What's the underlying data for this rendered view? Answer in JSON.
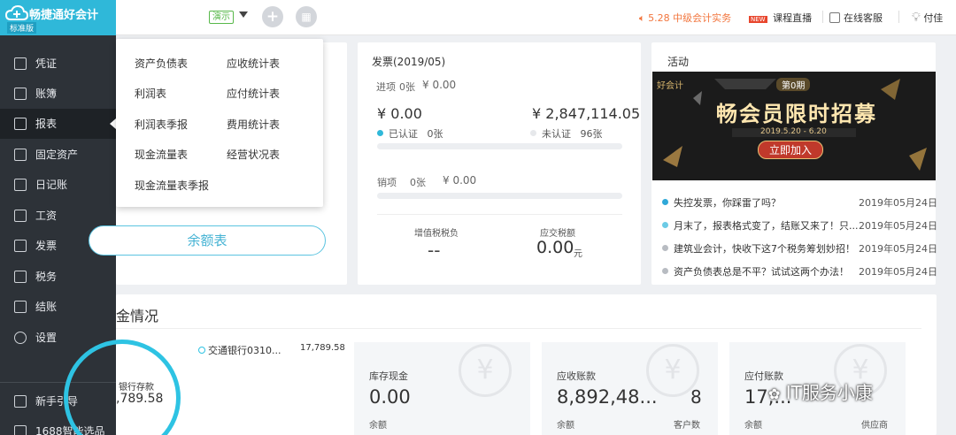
{
  "app": {
    "name": "畅捷通好会计",
    "edition": "标准版",
    "mode_badge": "演示"
  },
  "header": {
    "promo": "5.28 中级会计实务",
    "live_badge": "NEW",
    "live": "课程直播",
    "support": "在线客服",
    "user": "付佳"
  },
  "sidebar": {
    "items": [
      {
        "label": "凭证",
        "icon": "voucher-icon"
      },
      {
        "label": "账簿",
        "icon": "ledger-icon"
      },
      {
        "label": "报表",
        "icon": "report-icon"
      },
      {
        "label": "固定资产",
        "icon": "asset-icon"
      },
      {
        "label": "日记账",
        "icon": "journal-icon"
      },
      {
        "label": "工资",
        "icon": "salary-icon"
      },
      {
        "label": "发票",
        "icon": "invoice-icon"
      },
      {
        "label": "税务",
        "icon": "tax-icon"
      },
      {
        "label": "结账",
        "icon": "close-books-icon"
      },
      {
        "label": "设置",
        "icon": "gear-icon"
      }
    ],
    "bottom_items": [
      {
        "label": "新手引导",
        "icon": "guide-icon"
      },
      {
        "label": "1688智能选品",
        "icon": "shop-icon"
      }
    ]
  },
  "report_menu": {
    "col1": [
      "资产负债表",
      "利润表",
      "利润表季报",
      "现金流量表",
      "现金流量表季报"
    ],
    "col2": [
      "应收统计表",
      "应付统计表",
      "费用统计表",
      "经营状况表"
    ]
  },
  "balance_button": "余额表",
  "invoice": {
    "title": "发票(2019/05)",
    "input_label": "进项",
    "input_count": "0张",
    "input_amount": "¥ 0.00",
    "certified_amount": "¥ 0.00",
    "uncertified_amount": "¥ 2,847,114.05",
    "certified_label": "已认证",
    "certified_count": "0张",
    "uncertified_label": "未认证",
    "uncertified_count": "96张",
    "output_label": "销项",
    "output_count": "0张",
    "output_amount": "¥ 0.00",
    "vat_label": "增值税税负",
    "vat_value": "--",
    "tax_due_label": "应交税额",
    "tax_due_value": "0.00",
    "tax_due_unit": "元"
  },
  "activity": {
    "title": "活动",
    "banner": {
      "brand": "好会计",
      "issue": "第0期",
      "headline": "畅会员限时招募",
      "dates": "2019.5.20 - 6.20",
      "cta": "立即加入"
    },
    "news": [
      {
        "text": "失控发票，你踩雷了吗？",
        "date": "2019年05月24日",
        "dot": "#2fa8d8"
      },
      {
        "text": "月末了，报表格式变了，结账又来了！只...",
        "date": "2019年05月24日",
        "dot": "#6ccbe6"
      },
      {
        "text": "建筑业会计，快收下这7个税务筹划妙招！",
        "date": "2019年05月24日",
        "dot": "#b8bcc2"
      },
      {
        "text": "资产负债表总是不平？试试这两个办法！",
        "date": "2019年05月24日",
        "dot": "#b8bcc2"
      }
    ]
  },
  "funds": {
    "title": "金情况",
    "circle_label": "银行存款",
    "circle_value": ",789.58",
    "bank_name": "交通银行0310...",
    "bank_amount": "17,789.58",
    "tiles": [
      {
        "label": "库存现金",
        "value": "0.00",
        "sub": "余额",
        "count": "",
        "count_label": ""
      },
      {
        "label": "应收账款",
        "value": "8,892,48...",
        "sub": "余额",
        "count": "8",
        "count_label": "客户数"
      },
      {
        "label": "应付账款",
        "value": "17,...",
        "sub": "余额",
        "count": "",
        "count_label": "供应商"
      }
    ]
  },
  "watermark": "IT服务小康",
  "colors": {
    "brand": "#2fb8d9",
    "sidebar": "#2d3238",
    "promo": "#f2753d",
    "accent": "#2ec3e3"
  }
}
